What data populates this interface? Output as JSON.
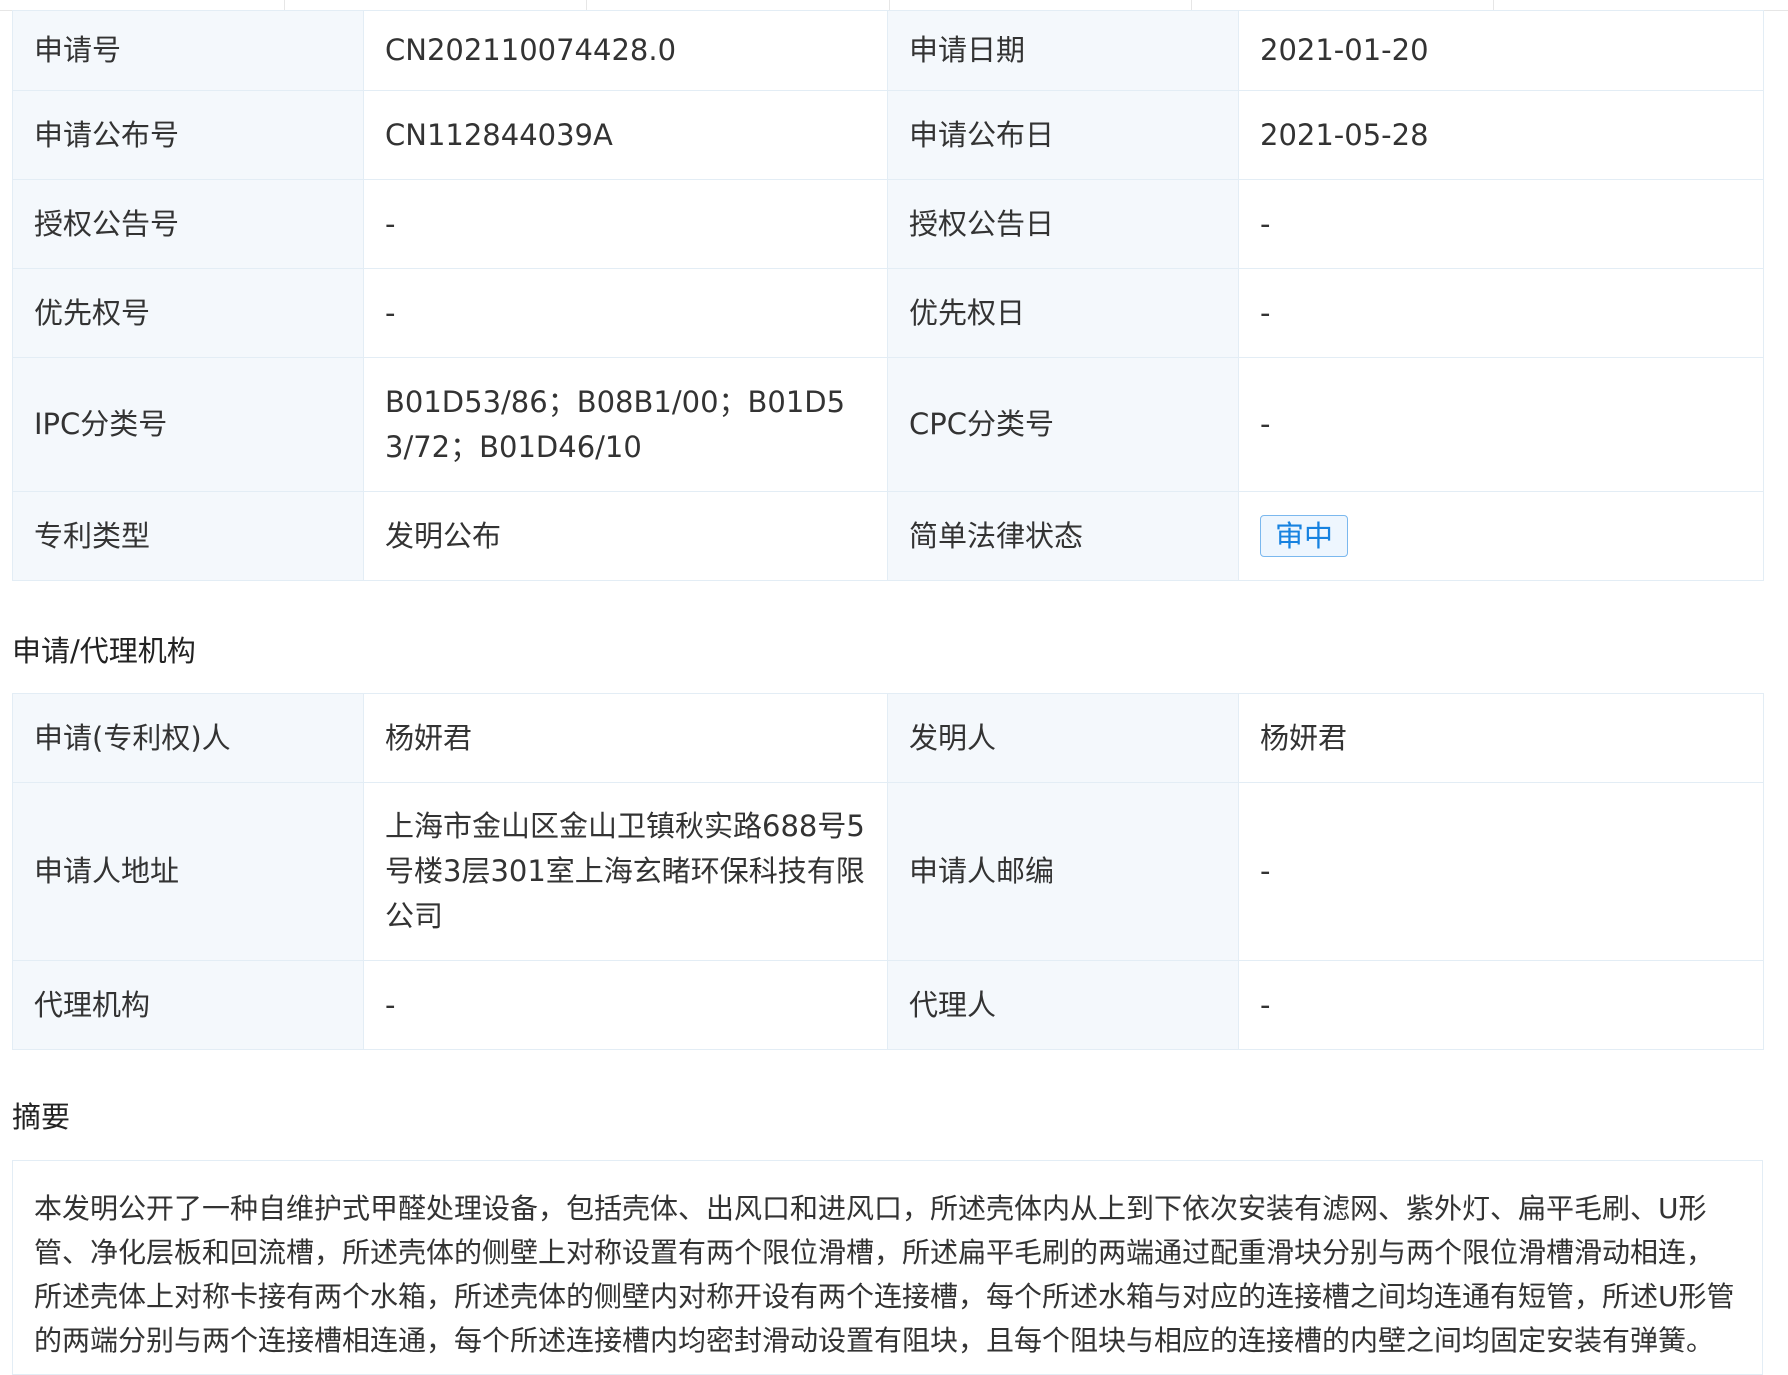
{
  "basic_info": {
    "rows": [
      {
        "label1": "申请号",
        "value1": "CN202110074428.0",
        "label2": "申请日期",
        "value2": "2021-01-20"
      },
      {
        "label1": "申请公布号",
        "value1": "CN112844039A",
        "label2": "申请公布日",
        "value2": "2021-05-28"
      },
      {
        "label1": "授权公告号",
        "value1": "-",
        "label2": "授权公告日",
        "value2": "-"
      },
      {
        "label1": "优先权号",
        "value1": "-",
        "label2": "优先权日",
        "value2": "-"
      },
      {
        "label1": "IPC分类号",
        "value1": "B01D53/86；B08B1/00；B01D53/72；B01D46/10",
        "label2": "CPC分类号",
        "value2": "-"
      },
      {
        "label1": "专利类型",
        "value1": "发明公布",
        "label2": "简单法律状态",
        "value2": "审中"
      }
    ]
  },
  "agency_section": {
    "title": "申请/代理机构",
    "rows": [
      {
        "label1": "申请(专利权)人",
        "value1": "杨妍君",
        "label2": "发明人",
        "value2": "杨妍君"
      },
      {
        "label1": "申请人地址",
        "value1": "上海市金山区金山卫镇秋实路688号5号楼3层301室上海玄睹环保科技有限公司",
        "label2": "申请人邮编",
        "value2": "-"
      },
      {
        "label1": "代理机构",
        "value1": "-",
        "label2": "代理人",
        "value2": "-"
      }
    ]
  },
  "abstract_section": {
    "title": "摘要",
    "text": "本发明公开了一种自维护式甲醛处理设备，包括壳体、出风口和进风口，所述壳体内从上到下依次安装有滤网、紫外灯、扁平毛刷、U形管、净化层板和回流槽，所述壳体的侧壁上对称设置有两个限位滑槽，所述扁平毛刷的两端通过配重滑块分别与两个限位滑槽滑动相连，所述壳体上对称卡接有两个水箱，所述壳体的侧壁内对称开设有两个连接槽，每个所述水箱与对应的连接槽之间均连通有短管，所述U形管的两端分别与两个连接槽相连通，每个所述连接槽内均密封滑动设置有阻块，且每个阻块与相应的连接槽的内壁之间均固定安装有弹簧。"
  }
}
